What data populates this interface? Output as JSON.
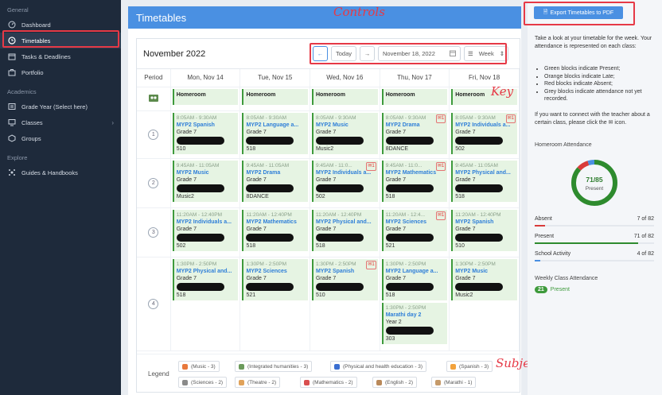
{
  "sidebar": {
    "sections": [
      "General",
      "Academics",
      "Explore"
    ],
    "items": [
      {
        "label": "Dashboard",
        "icon": "dashboard-icon"
      },
      {
        "label": "Timetables",
        "icon": "clock-icon"
      },
      {
        "label": "Tasks & Deadlines",
        "icon": "calendar-icon"
      },
      {
        "label": "Portfolio",
        "icon": "briefcase-icon"
      },
      {
        "label": "Grade Year (Select here)",
        "icon": "list-icon"
      },
      {
        "label": "Classes",
        "icon": "monitor-icon"
      },
      {
        "label": "Groups",
        "icon": "cube-icon"
      },
      {
        "label": "Guides & Handbooks",
        "icon": "hub-icon"
      }
    ]
  },
  "header": {
    "title": "Timetables"
  },
  "calendar": {
    "month": "November 2022",
    "today_label": "Today",
    "date_value": "November 18, 2022",
    "view_label": "Week",
    "period_header": "Period",
    "days": [
      "Mon, Nov 14",
      "Tue, Nov 15",
      "Wed, Nov 16",
      "Thu, Nov 17",
      "Fri, Nov 18"
    ],
    "homeroom_label": "Homeroom",
    "periods": [
      {
        "num": "1",
        "cells": [
          [
            {
              "time": "8:05AM - 9:30AM",
              "subject": "MYP2 Spanish",
              "grade": "Grade 7",
              "room": "510",
              "mail": false
            }
          ],
          [
            {
              "time": "8:05AM - 9:30AM",
              "subject": "MYP2 Language a...",
              "grade": "Grade 7",
              "room": "518",
              "mail": false
            }
          ],
          [
            {
              "time": "8:05AM - 9:30AM",
              "subject": "MYP2 Music",
              "grade": "Grade 7",
              "room": "Music2",
              "mail": false
            }
          ],
          [
            {
              "time": "8:05AM - 9:30AM",
              "subject": "MYP2 Drama",
              "grade": "Grade 7",
              "room": "8DANCE",
              "mail": true
            }
          ],
          [
            {
              "time": "8:05AM - 9:30AM",
              "subject": "MYP2 Individuals a...",
              "grade": "Grade 7",
              "room": "502",
              "mail": true
            }
          ]
        ]
      },
      {
        "num": "2",
        "cells": [
          [
            {
              "time": "9:45AM - 11:05AM",
              "subject": "MYP2 Music",
              "grade": "Grade 7",
              "room": "Music2",
              "mail": false
            }
          ],
          [
            {
              "time": "9:45AM - 11:05AM",
              "subject": "MYP2 Drama",
              "grade": "Grade 7",
              "room": "8DANCE",
              "mail": false
            }
          ],
          [
            {
              "time": "9:45AM - 11:0...",
              "subject": "MYP2 Individuals a...",
              "grade": "Grade 7",
              "room": "502",
              "mail": true
            }
          ],
          [
            {
              "time": "9:45AM - 11:0...",
              "subject": "MYP2 Mathematics",
              "grade": "Grade 7",
              "room": "518",
              "mail": true
            }
          ],
          [
            {
              "time": "9:45AM - 11:05AM",
              "subject": "MYP2 Physical and...",
              "grade": "Grade 7",
              "room": "518",
              "mail": false
            }
          ]
        ]
      },
      {
        "num": "3",
        "cells": [
          [
            {
              "time": "11:20AM - 12:40PM",
              "subject": "MYP2 Individuals a...",
              "grade": "Grade 7",
              "room": "502",
              "mail": false
            }
          ],
          [
            {
              "time": "11:20AM - 12:40PM",
              "subject": "MYP2 Mathematics",
              "grade": "Grade 7",
              "room": "518",
              "mail": false
            }
          ],
          [
            {
              "time": "11:20AM - 12:40PM",
              "subject": "MYP2 Physical and...",
              "grade": "Grade 7",
              "room": "518",
              "mail": false
            }
          ],
          [
            {
              "time": "11:20AM - 12:4...",
              "subject": "MYP2 Sciences",
              "grade": "Grade 7",
              "room": "521",
              "mail": true
            }
          ],
          [
            {
              "time": "11:20AM - 12:40PM",
              "subject": "MYP2 Spanish",
              "grade": "Grade 7",
              "room": "510",
              "mail": false
            }
          ]
        ]
      },
      {
        "num": "4",
        "cells": [
          [
            {
              "time": "1:30PM - 2:50PM",
              "subject": "MYP2 Physical and...",
              "grade": "Grade 7",
              "room": "518",
              "mail": false
            }
          ],
          [
            {
              "time": "1:30PM - 2:50PM",
              "subject": "MYP2 Sciences",
              "grade": "Grade 7",
              "room": "521",
              "mail": false
            }
          ],
          [
            {
              "time": "1:30PM - 2:50PM",
              "subject": "MYP2 Spanish",
              "grade": "Grade 7",
              "room": "510",
              "mail": true
            }
          ],
          [
            {
              "time": "1:30PM - 2:50PM",
              "subject": "MYP2 Language a...",
              "grade": "Grade 7",
              "room": "518",
              "mail": false
            },
            {
              "time": "1:30PM - 2:50PM",
              "subject": "Marathi day 2",
              "grade": "Year 2",
              "room": "303",
              "mail": false
            }
          ],
          [
            {
              "time": "1:30PM - 2:50PM",
              "subject": "MYP2 Music",
              "grade": "Grade 7",
              "room": "Music2",
              "mail": false
            }
          ]
        ]
      }
    ],
    "legend_title": "Legend",
    "legend": [
      {
        "label": "(Music - 3)",
        "color": "#e8793c"
      },
      {
        "label": "(Integrated humanities - 3)",
        "color": "#6b9a5b"
      },
      {
        "label": "(Physical and health education - 3)",
        "color": "#3b6fd1"
      },
      {
        "label": "(Spanish - 3)",
        "color": "#f2a23c"
      },
      {
        "label": "(Sciences - 2)",
        "color": "#8a8a8a"
      },
      {
        "label": "(Theatre - 2)",
        "color": "#e0a25a"
      },
      {
        "label": "(Mathematics - 2)",
        "color": "#d94f4f"
      },
      {
        "label": "(English - 2)",
        "color": "#b9895a"
      },
      {
        "label": "(Marathi - 1)",
        "color": "#c59a6a"
      }
    ]
  },
  "right": {
    "export_label": "Export Timetables to PDF",
    "intro": "Take a look at your timetable for the week. Your attendance is represented on each class:",
    "bullets": [
      "Green blocks indicate Present;",
      "Orange blocks indicate Late;",
      "Red blocks indicate Absent;",
      "Grey blocks indicate attendance not yet recorded."
    ],
    "connect": "If you want to connect with the teacher about a certain class, please click the ✉ icon.",
    "homeroom_title": "Homeroom Attendance",
    "donut_value": "71/85",
    "donut_label": "Present",
    "attendance": [
      {
        "label": "Absent",
        "value": "7 of 82",
        "fraction": 0.085,
        "color": "#d93b3b"
      },
      {
        "label": "Present",
        "value": "71 of 82",
        "fraction": 0.866,
        "color": "#2e8b2e"
      },
      {
        "label": "School Activity",
        "value": "4 of 82",
        "fraction": 0.049,
        "color": "#4a90e2"
      }
    ],
    "weekly_title": "Weekly Class Attendance",
    "weekly_count": "21",
    "weekly_label": "Present"
  },
  "annotations": {
    "controls": "Controls",
    "key": "Key",
    "subjects": "Subjects"
  },
  "colors": {
    "accent": "#4a90e2",
    "present": "#3e9a3c",
    "sidebar": "#1e2a3b",
    "annotation": "#e63946"
  }
}
